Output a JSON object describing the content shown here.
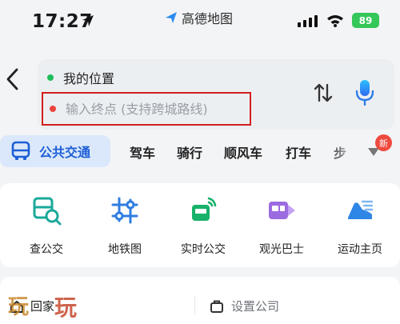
{
  "status_bar": {
    "time": "17:27",
    "app_name": "高德地图",
    "battery": "89",
    "battery_color": "#34c759"
  },
  "route": {
    "origin": "我的位置",
    "destination_value": "",
    "destination_placeholder": "输入终点 (支持跨城路线)"
  },
  "tabs": {
    "active": "公共交通",
    "items": [
      "驾车",
      "骑行",
      "顺风车",
      "打车",
      "步行"
    ],
    "visible_more": "步",
    "new_badge": "新",
    "accent": "#1d5fd6"
  },
  "tools": [
    {
      "label": "查公交",
      "icon": "bus-search-icon",
      "color": "#1aa99a"
    },
    {
      "label": "地铁图",
      "icon": "subway-map-icon",
      "color": "#2f7de1"
    },
    {
      "label": "实时公交",
      "icon": "realtime-bus-icon",
      "color": "#18b26b"
    },
    {
      "label": "观光巴士",
      "icon": "sightseeing-bus-icon",
      "color": "#9b6be0"
    },
    {
      "label": "运动主页",
      "icon": "running-shoe-icon",
      "color": "#2e86e6"
    }
  ],
  "favorites": {
    "home": "回家",
    "company": "设置公司"
  },
  "watermark": "玩玩"
}
